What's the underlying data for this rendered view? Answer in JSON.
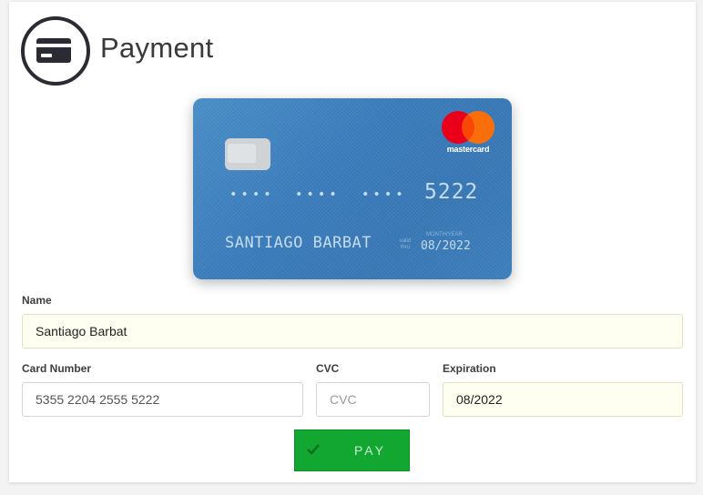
{
  "header": {
    "title": "Payment",
    "icon": "credit-card-icon"
  },
  "card_preview": {
    "dots_group": "••••",
    "last4": "5222",
    "holder": "SANTIAGO BARBAT",
    "valid_thru": "valid thru",
    "month_year": "MONTH/YEAR",
    "expiry": "08/2022",
    "brand": "mastercard",
    "colors": {
      "card": "#3b7dbd",
      "mc_red": "#eb001b",
      "mc_orange": "#f79e1b"
    }
  },
  "form": {
    "name": {
      "label": "Name",
      "value": "Santiago Barbat"
    },
    "card_number": {
      "label": "Card Number",
      "value": "5355 2204 2555 5222"
    },
    "cvc": {
      "label": "CVC",
      "placeholder": "CVC",
      "value": ""
    },
    "expiration": {
      "label": "Expiration",
      "value": "08/2022"
    }
  },
  "pay_button": {
    "label": "PAY",
    "icon": "check-icon",
    "color": "#12a731"
  }
}
